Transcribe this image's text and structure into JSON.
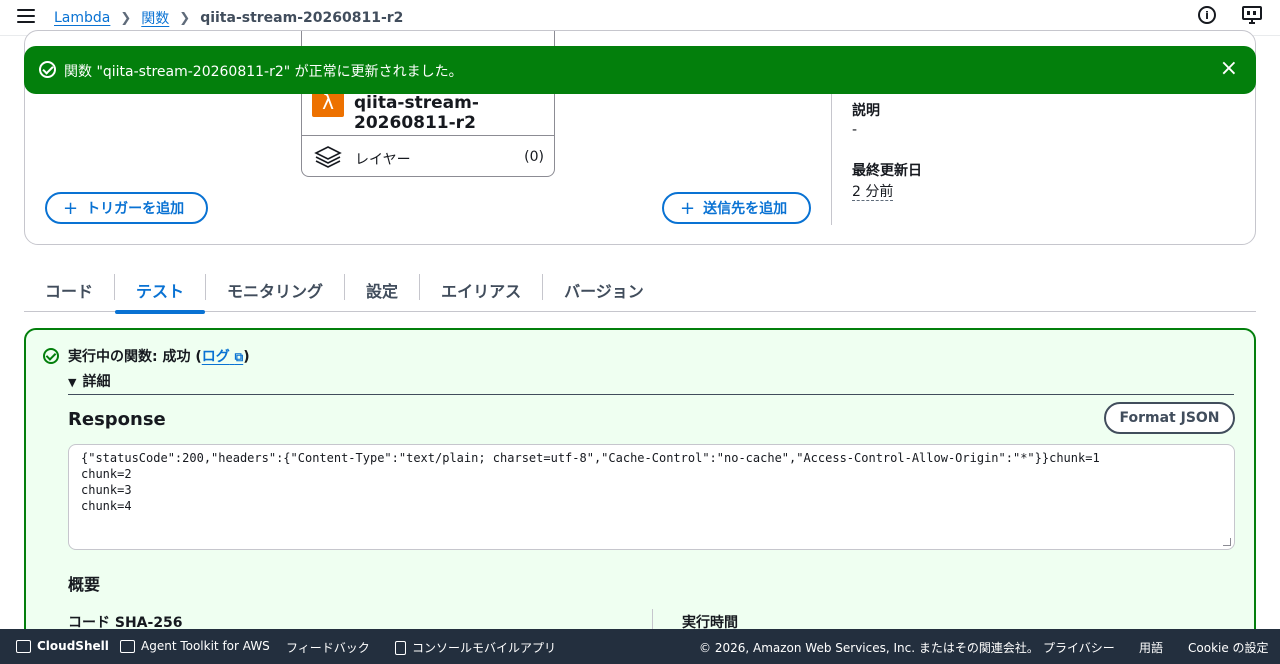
{
  "breadcrumbs": {
    "lambda": "Lambda",
    "functions": "関数",
    "current": "qiita-stream-20260811-r2"
  },
  "flash": {
    "message": "関数 \"qiita-stream-20260811-r2\" が正常に更新されました。",
    "close": "×"
  },
  "overview": {
    "function_name_line1": "qiita-stream-",
    "function_name_line2": "20260811-r2",
    "layers_label": "レイヤー",
    "layers_count": "(0)",
    "add_trigger": "トリガーを追加",
    "add_destination": "送信先を追加",
    "description_label": "説明",
    "description_value": "-",
    "last_modified_label": "最終更新日",
    "last_modified_value": "2 分前"
  },
  "tabs": [
    {
      "label": "コード"
    },
    {
      "label": "テスト"
    },
    {
      "label": "モニタリング"
    },
    {
      "label": "設定"
    },
    {
      "label": "エイリアス"
    },
    {
      "label": "バージョン"
    }
  ],
  "active_tab": "テスト",
  "result": {
    "status_prefix": "実行中の関数: 成功 (",
    "log_link": "ログ",
    "status_suffix": ")",
    "details_toggle": "詳細",
    "response_heading": "Response",
    "format_json": "Format JSON",
    "response_text": "{\"statusCode\":200,\"headers\":{\"Content-Type\":\"text/plain; charset=utf-8\",\"Cache-Control\":\"no-cache\",\"Access-Control-Allow-Origin\":\"*\"}}chunk=1\nchunk=2\nchunk=3\nchunk=4",
    "summary_heading": "概要",
    "code_sha_label": "コード SHA-256",
    "exec_time_label": "実行時間"
  },
  "footer": {
    "cloudshell": "CloudShell",
    "agent_toolkit": "Agent Toolkit for AWS",
    "feedback": "フィードバック",
    "mobile_app": "コンソールモバイルアプリ",
    "copyright": "© 2026, Amazon Web Services, Inc. またはその関連会社。",
    "privacy": "プライバシー",
    "terms": "用語",
    "cookie": "Cookie の設定"
  },
  "colors": {
    "link": "#0972d3",
    "success": "#037f0c",
    "success_bg": "#effff1",
    "footer_bg": "#232f3e",
    "lambda_orange": "#ed7100"
  }
}
